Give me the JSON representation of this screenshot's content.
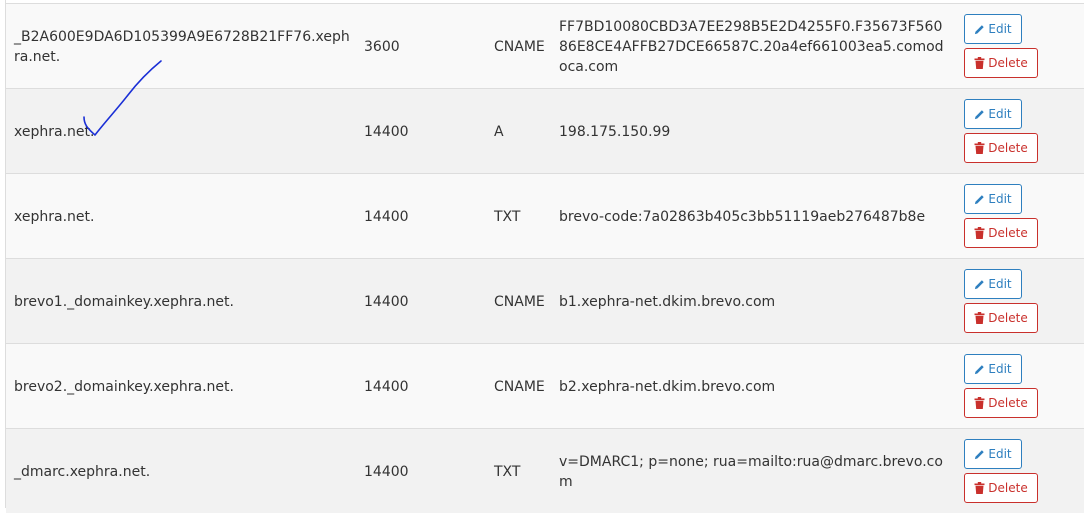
{
  "table": {
    "rows": [
      {
        "name": "_B2A600E9DA6D105399A9E6728B21FF76.xephra.net.",
        "ttl": "3600",
        "type": "CNAME",
        "record": "FF7BD10080CBD3A7EE298B5E2D4255F0.F35673F56086E8CE4AFFB27DCE66587C.20a4ef661003ea5.comodoca.com"
      },
      {
        "name": "xephra.net.",
        "ttl": "14400",
        "type": "A",
        "record": "198.175.150.99"
      },
      {
        "name": "xephra.net.",
        "ttl": "14400",
        "type": "TXT",
        "record": "brevo-code:7a02863b405c3bb51119aeb276487b8e"
      },
      {
        "name": "brevo1._domainkey.xephra.net.",
        "ttl": "14400",
        "type": "CNAME",
        "record": "b1.xephra-net.dkim.brevo.com"
      },
      {
        "name": "brevo2._domainkey.xephra.net.",
        "ttl": "14400",
        "type": "CNAME",
        "record": "b2.xephra-net.dkim.brevo.com"
      },
      {
        "name": "_dmarc.xephra.net.",
        "ttl": "14400",
        "type": "TXT",
        "record": "v=DMARC1; p=none; rua=mailto:rua@dmarc.brevo.com"
      }
    ]
  },
  "actions": {
    "edit_label": "Edit",
    "delete_label": "Delete"
  },
  "icons": {
    "edit": "pencil-icon",
    "delete": "trash-icon"
  },
  "colors": {
    "edit": "#2e7fbf",
    "delete": "#c9302c",
    "checkmark": "#1a2fd6"
  }
}
